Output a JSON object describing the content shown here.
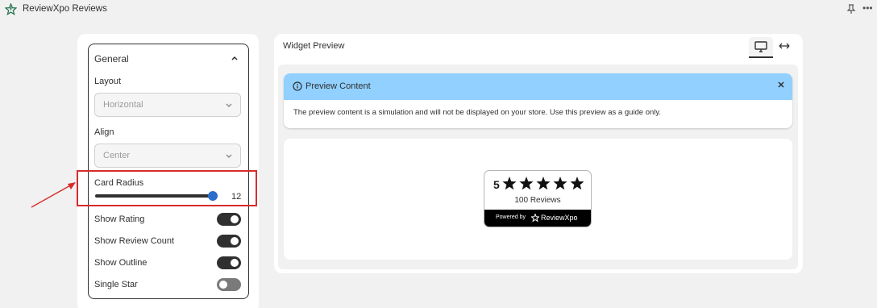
{
  "app": {
    "title": "ReviewXpo Reviews"
  },
  "sidebar": {
    "section_title": "General",
    "layout": {
      "label": "Layout",
      "value": "Horizontal"
    },
    "align": {
      "label": "Align",
      "value": "Center"
    },
    "card_radius": {
      "label": "Card Radius",
      "value": "12",
      "fraction": 0.96
    },
    "toggles": [
      {
        "label": "Show Rating",
        "on": true
      },
      {
        "label": "Show Review Count",
        "on": true
      },
      {
        "label": "Show Outline",
        "on": true
      },
      {
        "label": "Single Star",
        "on": false
      }
    ]
  },
  "preview": {
    "title": "Widget Preview",
    "banner": {
      "title": "Preview Content",
      "body": "The preview content is a simulation and will not be displayed on your store. Use this preview as a guide only."
    },
    "widget": {
      "rating": "5",
      "stars": 5,
      "count": "100 Reviews",
      "powered_by": "Powered by",
      "brand": "ReviewXpo"
    }
  },
  "colors": {
    "annotation": "#d82c2c",
    "banner_bg": "#91d0ff",
    "slider_thumb": "#2c6ecb"
  }
}
